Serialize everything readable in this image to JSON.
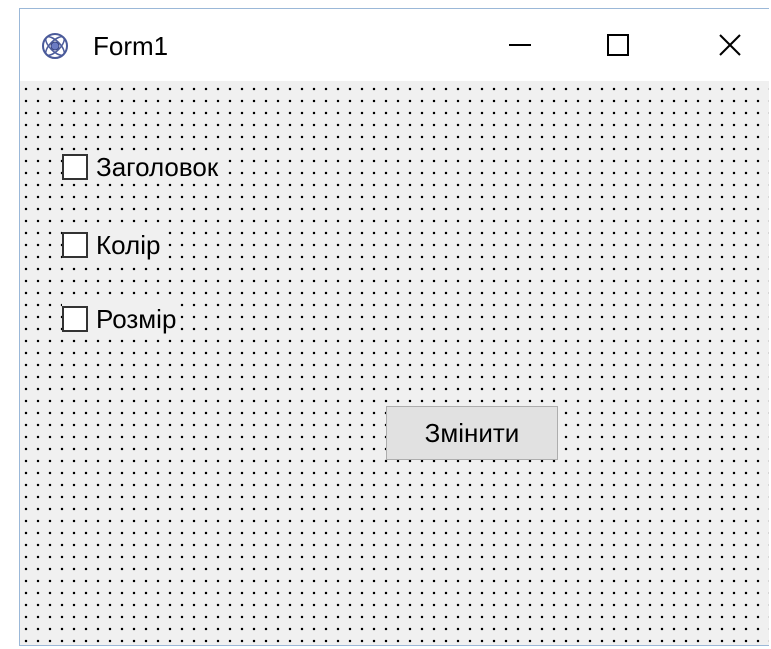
{
  "window": {
    "title": "Form1",
    "icon": "delphi-form-icon"
  },
  "title_controls": {
    "minimize_icon": "minimize-icon",
    "maximize_icon": "maximize-icon",
    "close_icon": "close-icon"
  },
  "form": {
    "checkboxes": [
      {
        "label": "Заголовок",
        "checked": false
      },
      {
        "label": "Колір",
        "checked": false
      },
      {
        "label": "Розмір",
        "checked": false
      }
    ],
    "button_label": "Змінити"
  },
  "colors": {
    "client_background": "#f0f0f0",
    "grid_dots": "#000000",
    "button_face": "#e1e1e1",
    "button_border": "#adadad",
    "window_border": "#9bb8d8"
  }
}
